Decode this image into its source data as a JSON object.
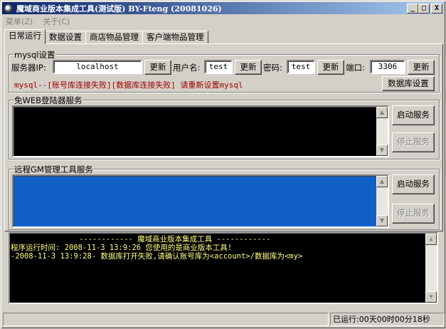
{
  "window": {
    "title": "魔域商业版本集成工具(测试版) BY-Fteng (20081026)",
    "minimize_glyph": "_",
    "maximize_glyph": "□",
    "close_glyph": "X"
  },
  "menubar": {
    "items": [
      {
        "label": "菜单(Z)"
      },
      {
        "label": "关于(C)"
      }
    ]
  },
  "tabs": [
    {
      "label": "日常运行",
      "active": true
    },
    {
      "label": "数据设置",
      "active": false
    },
    {
      "label": "商店物品管理",
      "active": false
    },
    {
      "label": "客户端物品管理",
      "active": false
    }
  ],
  "mysql": {
    "group_title": "mysql设置",
    "server_ip_label": "服务器IP:",
    "server_ip_value": "localhost",
    "update1": "更新",
    "username_label": "用户名:",
    "username_value": "test",
    "update2": "更新",
    "password_label": "密码:",
    "password_value": "test",
    "update3": "更新",
    "port_label": "端口:",
    "port_value": "3306",
    "update4": "更新",
    "status_text": "mysql--[账号库连接失败][数据库连接失败]  请重新设置mysql",
    "db_settings_button": "数据库设置"
  },
  "web_login_service": {
    "group_title": "免WEB登陆器服务",
    "start_button": "启动服务",
    "stop_button": "停止服务"
  },
  "gm_service": {
    "group_title": "远程GM管理工具服务",
    "start_button": "启动服务",
    "stop_button": "停止服务"
  },
  "console": {
    "lines": [
      "------------ 魔域商业版本集成工具 ------------",
      "程序运行时间: 2008-11-3 13:9:26 您使用的是商业版本工具!",
      "-2008-11-3 13:9:28- 数据库打开失败,请确认账号库为<account>/数据库为<my>"
    ]
  },
  "statusbar": {
    "runtime": "已运行:00天00时00分18秒"
  },
  "colors": {
    "title_start": "#0a246a",
    "title_end": "#a6caf0",
    "face": "#d4d0c8",
    "gm_list_bg": "#1060c8",
    "console_text": "#ffff80",
    "error_text": "#a00000"
  }
}
